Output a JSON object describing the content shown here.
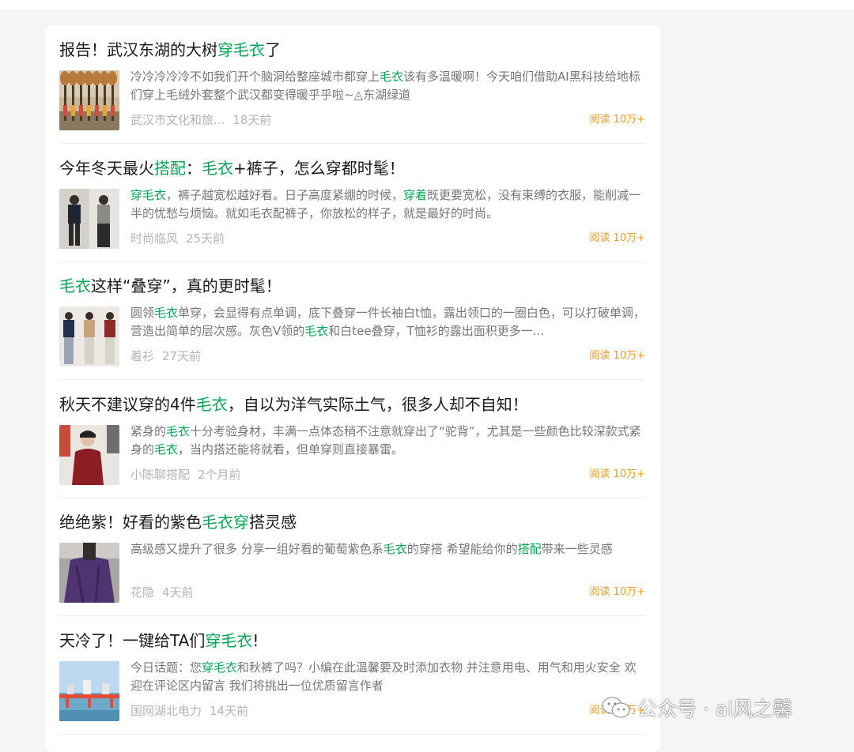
{
  "colors": {
    "highlight": "#07a654",
    "reads": "#f29b2d",
    "meta": "#b5b5b5"
  },
  "articles": [
    {
      "title_parts": [
        "报告！武汉东湖的大树",
        "穿毛衣",
        "了"
      ],
      "desc_parts": [
        "冷冷冷冷冷不如我们开个脑洞给整座城市都穿上",
        "毛衣",
        "该有多温暖啊！今天咱们借助AI黑科技给地标们穿上毛绒外套整个武汉都变得暖乎乎啦~◬东湖绿道"
      ],
      "source": "武汉市文化和旅...",
      "time": "18天前",
      "reads": "阅读 10万+",
      "thumb_icon": "tree-lined-lake-photo"
    },
    {
      "title_parts": [
        "今年冬天最火",
        "搭配",
        "：",
        "毛衣",
        "+裤子，怎么穿都时髦！"
      ],
      "desc_parts": [
        "穿毛衣",
        "，裤子越宽松越好看。日子高度紧绷的时候，",
        "穿着",
        "既更要宽松，没有束缚的衣服，能削减一半的忧愁与烦恼。就如毛衣配裤子，你放松的样子，就是最好的时尚。"
      ],
      "source": "时尚临风",
      "time": "25天前",
      "reads": "阅读 10万+",
      "thumb_icon": "outfit-photo"
    },
    {
      "title_parts": [
        "",
        "毛衣",
        "这样“叠穿”，真的更时髦！"
      ],
      "desc_parts": [
        "圆领",
        "毛衣",
        "单穿，会显得有点单调，底下叠穿一件长袖白t恤，露出领口的一圈白色，可以打破单调，营造出简单的层次感。灰色V领的",
        "毛衣",
        "和白tee叠穿，T恤衫的露出面积更多一..."
      ],
      "source": "着衫",
      "time": "27天前",
      "reads": "阅读 10万+",
      "thumb_icon": "layered-outfit-photo"
    },
    {
      "title_parts": [
        "秋天不建议穿的4件",
        "毛衣",
        "，自以为洋气实际土气，很多人却不自知！"
      ],
      "desc_parts": [
        "紧身的",
        "毛衣",
        "十分考验身材，丰满一点体态稍不注意就穿出了“驼背”，尤其是一些颜色比较深款式紧身的",
        "毛衣",
        "，当内搭还能将就看，但单穿则直接暴雷。"
      ],
      "source": "小陈聊搭配",
      "time": "2个月前",
      "reads": "阅读 10万+",
      "thumb_icon": "red-sweater-photo"
    },
    {
      "title_parts": [
        "绝绝紫！好看的紫色",
        "毛衣穿",
        "搭灵感"
      ],
      "desc_parts": [
        "高级感又提升了很多 分享一组好看的葡萄紫色系",
        "毛衣",
        "的穿搭 希望能给你的",
        "搭配",
        "带来一些灵感"
      ],
      "source": "花隐",
      "time": "4天前",
      "reads": "阅读 10万+",
      "thumb_icon": "purple-sweater-photo"
    },
    {
      "title_parts": [
        "天冷了！一键给TA们",
        "穿毛衣",
        "!"
      ],
      "desc_parts": [
        "今日话题：您",
        "穿毛衣",
        "和秋裤了吗？小编在此温馨要及时添加衣物 并注意用电、用气和用火安全 欢迎在评论区内留言 我们将挑出一位优质留言作者"
      ],
      "source": "国网湖北电力",
      "time": "14天前",
      "reads": "阅读 10万+",
      "thumb_icon": "city-bridge-photo"
    }
  ],
  "watermark": {
    "text": "公众号 · ai风之馨",
    "icon": "wechat-icon"
  }
}
